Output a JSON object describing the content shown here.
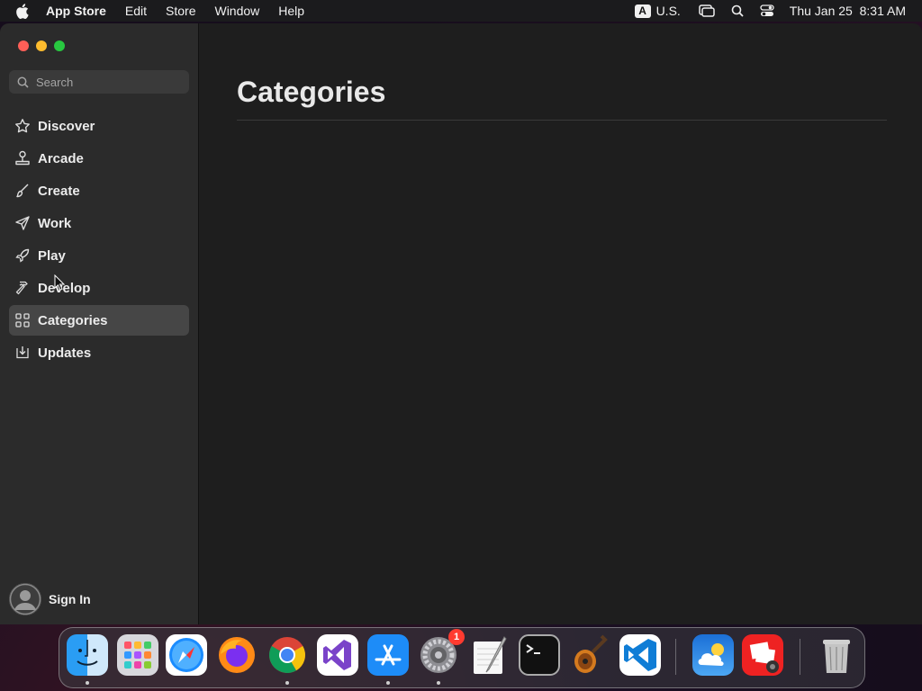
{
  "menubar": {
    "app_name": "App Store",
    "menus": [
      "Edit",
      "Store",
      "Window",
      "Help"
    ],
    "input_source_badge": "A",
    "input_source": "U.S.",
    "datetime": "Thu Jan 25  8:31 AM",
    "icons": [
      "apple-icon",
      "screen-mirroring-icon",
      "spotlight-search-icon",
      "control-center-icon"
    ]
  },
  "sidebar": {
    "search_placeholder": "Search",
    "items": [
      {
        "label": "Discover",
        "icon": "star-icon"
      },
      {
        "label": "Arcade",
        "icon": "joystick-icon"
      },
      {
        "label": "Create",
        "icon": "brush-icon"
      },
      {
        "label": "Work",
        "icon": "paper-plane-icon"
      },
      {
        "label": "Play",
        "icon": "rocket-icon"
      },
      {
        "label": "Develop",
        "icon": "hammer-icon"
      },
      {
        "label": "Categories",
        "icon": "grid-icon",
        "selected": true
      },
      {
        "label": "Updates",
        "icon": "download-icon"
      }
    ],
    "sign_in": "Sign In"
  },
  "main": {
    "title": "Categories"
  },
  "dock": {
    "apps": [
      "Finder",
      "Launchpad",
      "Safari",
      "Firefox",
      "Chrome",
      "Visual Studio",
      "App Store",
      "System Settings",
      "TextEdit",
      "Terminal",
      "GarageBand",
      "VS Code",
      "Weather",
      "Photo Booth",
      "Trash"
    ],
    "system_settings_badge": "1"
  },
  "colors": {
    "sidebar_bg": "#2b2b2b",
    "main_bg": "#1e1e1e",
    "selected_item_bg": "#464646",
    "close": "#fe5f57",
    "minimize": "#febc2e",
    "maximize": "#28c840"
  }
}
